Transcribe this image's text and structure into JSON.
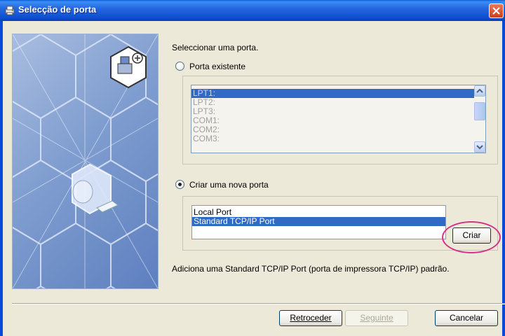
{
  "window": {
    "title": "Selecção de porta",
    "icon": "printer-icon",
    "close_icon": "close-icon"
  },
  "main": {
    "prompt": "Seleccionar uma porta.",
    "radio_existing_label": "Porta existente",
    "existing_ports": [
      "LPT1:",
      "LPT2:",
      "LPT3:",
      "COM1:",
      "COM2:",
      "COM3:"
    ],
    "existing_selected": "LPT1:",
    "radio_new_label": "Criar uma nova porta",
    "new_port_types": [
      "Local Port",
      "Standard TCP/IP Port"
    ],
    "new_selected": "Standard TCP/IP Port",
    "create_button": "Criar",
    "description": "Adiciona uma Standard TCP/IP Port (porta de impressora TCP/IP) padrão."
  },
  "footer": {
    "back_label": "Retroceder",
    "next_label": "Seguinte",
    "cancel_label": "Cancelar"
  },
  "colors": {
    "titlebar": "#0A5FD8",
    "selection": "#316AC5",
    "highlight_ellipse": "#D4338C"
  }
}
